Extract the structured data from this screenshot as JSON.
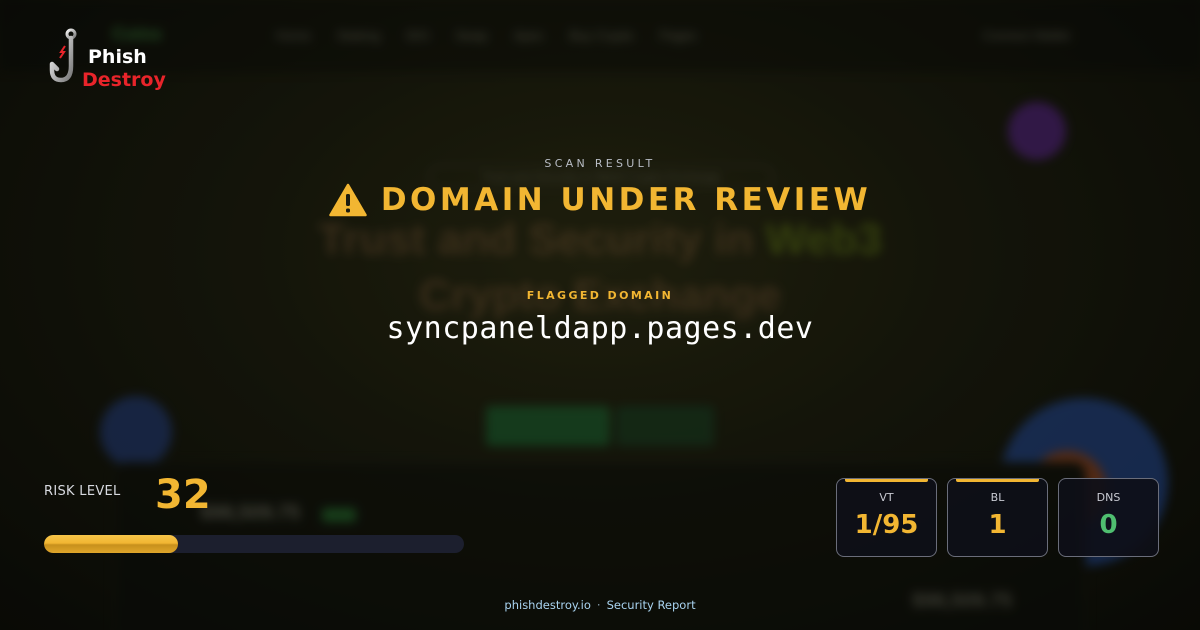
{
  "brand": {
    "line1": "Phish",
    "line2": "Destroy"
  },
  "background_site": {
    "logo": "Coinx",
    "nav": [
      "Home",
      "Staking",
      "IDO",
      "Swap",
      "Apex",
      "Buy Crypto",
      "Pages"
    ],
    "connect": "Connect Wallet",
    "pill": "Trust and Security in Web3 Crypto Exchange",
    "headline_a": "Trust and Security in ",
    "headline_b": "Web3",
    "headline_c": "Crypto Exchange",
    "cta_primary": "Get Started",
    "cta_secondary": "Explore",
    "stat_value": "$98,509.75",
    "stat_value_2": "$98,509.75"
  },
  "scan": {
    "kicker": "SCAN RESULT",
    "title": "DOMAIN UNDER REVIEW",
    "flag_label": "FLAGGED DOMAIN",
    "domain": "syncpaneldapp.pages.dev"
  },
  "risk": {
    "label": "RISK LEVEL",
    "value": "32",
    "percent": 32
  },
  "stats": [
    {
      "label": "VT",
      "value": "1/95",
      "color": "#f2b632"
    },
    {
      "label": "BL",
      "value": "1",
      "color": "#f2b632"
    },
    {
      "label": "DNS",
      "value": "0",
      "color": "#4fbf70"
    }
  ],
  "footer": {
    "site": "phishdestroy.io",
    "separator": "·",
    "label": "Security Report"
  },
  "colors": {
    "accent": "#f2b632",
    "ok": "#4fbf70",
    "danger": "#e8242a"
  }
}
